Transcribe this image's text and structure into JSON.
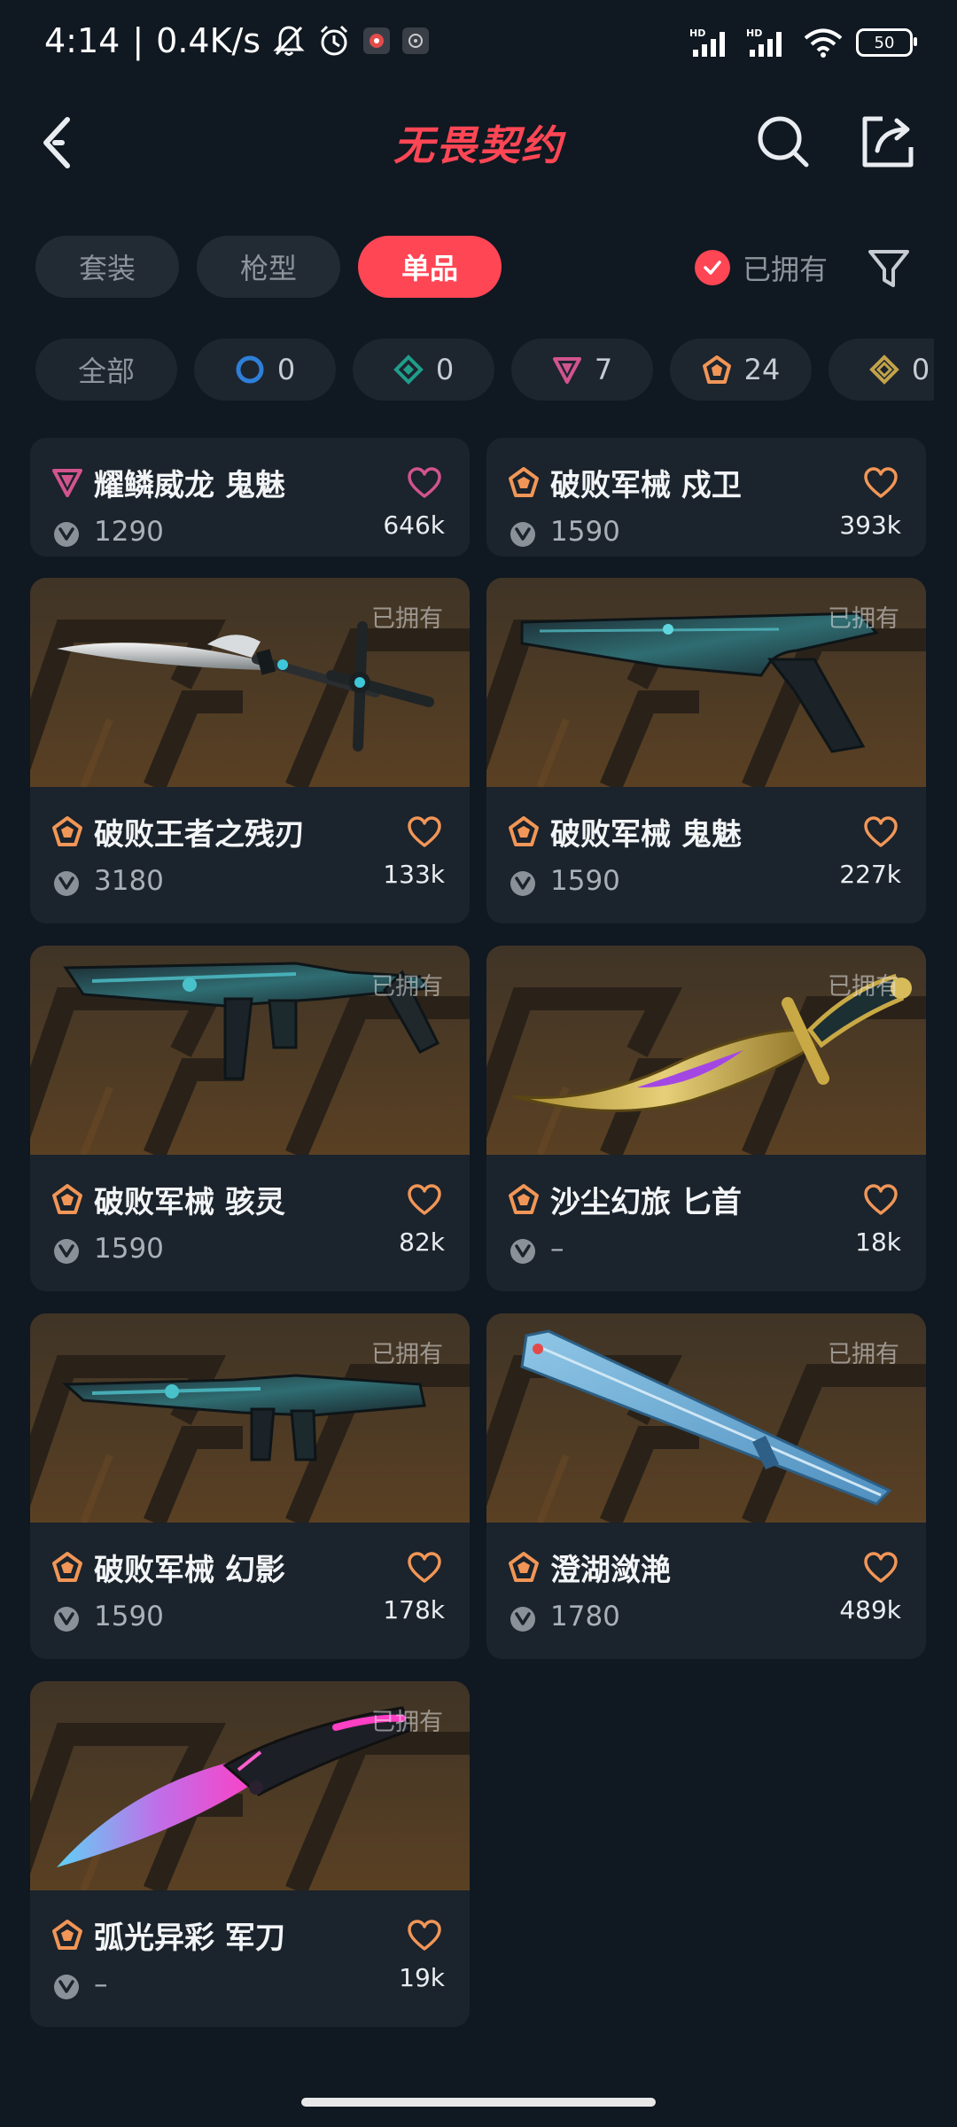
{
  "status_bar": {
    "time": "4:14",
    "speed": "0.4K/s",
    "battery": "50",
    "signal_label": "HD"
  },
  "header": {
    "title": "无畏契约"
  },
  "tabs": [
    {
      "label": "套装",
      "active": false
    },
    {
      "label": "枪型",
      "active": false
    },
    {
      "label": "单品",
      "active": true
    }
  ],
  "owned_filter": {
    "label": "已拥有",
    "checked": true
  },
  "rarity_chips": [
    {
      "label": "全部",
      "count": ""
    },
    {
      "icon": "select-tier-icon",
      "color": "#2e7fd8",
      "count": "0"
    },
    {
      "icon": "deluxe-tier-icon",
      "color": "#1f9e8a",
      "count": "0"
    },
    {
      "icon": "premium-tier-icon",
      "color": "#d1548e",
      "count": "7"
    },
    {
      "icon": "exclusive-tier-icon",
      "color": "#f19657",
      "count": "24"
    },
    {
      "icon": "ultra-tier-icon",
      "color": "#c2a34a",
      "count": "0"
    }
  ],
  "items": [
    {
      "name": "耀鳞威龙 鬼魅",
      "price": "1290",
      "likes": "646k",
      "tier": "premium",
      "owned_label": "",
      "image": ""
    },
    {
      "name": "破败军械 戍卫",
      "price": "1590",
      "likes": "393k",
      "tier": "exclusive",
      "owned_label": "",
      "image": ""
    },
    {
      "name": "破败王者之残刃",
      "price": "3180",
      "likes": "133k",
      "tier": "exclusive",
      "owned_label": "已拥有",
      "image": "sword"
    },
    {
      "name": "破败军械 鬼魅",
      "price": "1590",
      "likes": "227k",
      "tier": "exclusive",
      "owned_label": "已拥有",
      "image": "pistol"
    },
    {
      "name": "破败军械 骇灵",
      "price": "1590",
      "likes": "82k",
      "tier": "exclusive",
      "owned_label": "已拥有",
      "image": "smg"
    },
    {
      "name": "沙尘幻旅 匕首",
      "price": "–",
      "likes": "18k",
      "tier": "exclusive",
      "owned_label": "已拥有",
      "image": "dagger"
    },
    {
      "name": "破败军械 幻影",
      "price": "1590",
      "likes": "178k",
      "tier": "exclusive",
      "owned_label": "已拥有",
      "image": "rifle"
    },
    {
      "name": "澄湖潋滟",
      "price": "1780",
      "likes": "489k",
      "tier": "exclusive",
      "owned_label": "已拥有",
      "image": "fan"
    },
    {
      "name": "弧光异彩 军刀",
      "price": "–",
      "likes": "19k",
      "tier": "exclusive",
      "owned_label": "已拥有",
      "image": "knife"
    }
  ],
  "colors": {
    "accent": "#ff4655",
    "background": "#101821",
    "card": "#1b232c",
    "exclusive": "#f19657",
    "premium": "#d1548e"
  }
}
